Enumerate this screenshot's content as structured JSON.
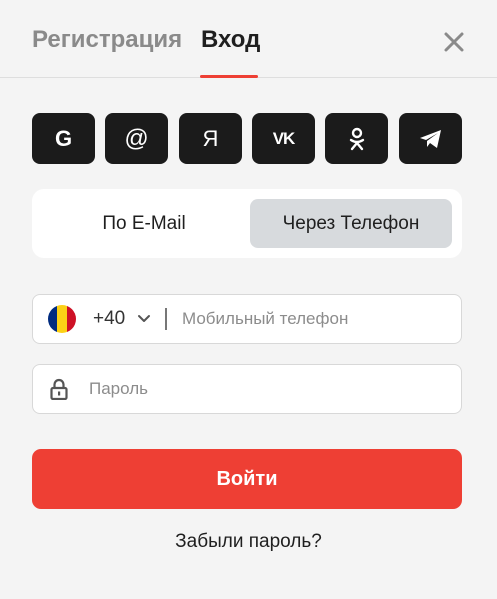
{
  "header": {
    "tabs": [
      {
        "label": "Регистрация",
        "active": false
      },
      {
        "label": "Вход",
        "active": true
      }
    ],
    "close_icon": "close-icon",
    "accent_color": "#ee3f34"
  },
  "social": {
    "buttons": [
      {
        "name": "google",
        "glyph": "G",
        "icon": "google-icon"
      },
      {
        "name": "email",
        "glyph": "@",
        "icon": "at-icon"
      },
      {
        "name": "yandex",
        "glyph": "Я",
        "icon": "yandex-icon"
      },
      {
        "name": "vk",
        "glyph": "VK",
        "icon": "vk-icon"
      },
      {
        "name": "odnoklassniki",
        "glyph": "",
        "icon": "odnoklassniki-icon"
      },
      {
        "name": "telegram",
        "glyph": "",
        "icon": "telegram-icon"
      }
    ]
  },
  "login_method": {
    "options": [
      {
        "label": "По E-Mail",
        "selected": false
      },
      {
        "label": "Через Телефон",
        "selected": true
      }
    ]
  },
  "phone": {
    "country_flag": "romania-flag",
    "flag_colors": [
      "#002b7f",
      "#fcd116",
      "#ce1126"
    ],
    "country_code": "+40",
    "value": "",
    "placeholder": "Мобильный телефон"
  },
  "password": {
    "value": "",
    "placeholder": "Пароль"
  },
  "submit": {
    "label": "Войти",
    "color": "#ee3f34"
  },
  "forgot_password": {
    "label": "Забыли пароль?"
  }
}
